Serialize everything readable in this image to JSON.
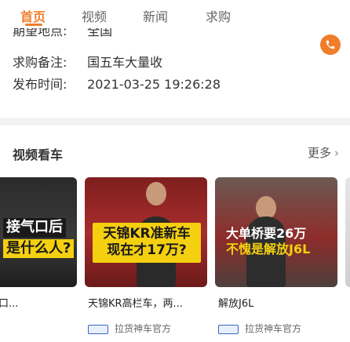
{
  "tabs": [
    {
      "label": "首页",
      "active": true
    },
    {
      "label": "视频",
      "active": false
    },
    {
      "label": "新闻",
      "active": false
    },
    {
      "label": "求购",
      "active": false
    }
  ],
  "info": {
    "cut_row": {
      "key": "期望地点:",
      "value": "全国"
    },
    "remark": {
      "key": "求购备注:",
      "value": "国五车大量收"
    },
    "publish_time": {
      "key": "发布时间:",
      "value": "2021-03-25 19:26:28"
    }
  },
  "phone_icon": "phone-icon",
  "section": {
    "title": "视频看车",
    "more_label": "更多",
    "more_icon": "chevron-right-icon"
  },
  "videos": [
    {
      "cap_line1": "接气口后",
      "cap_line2": "是什么人?",
      "title": "卡车接气口...",
      "source": ""
    },
    {
      "cap_line1": "天锦KR准新车",
      "cap_line2": "现在才17万?",
      "title": "天锦KR高栏车，两...",
      "source": "拉货神车官方"
    },
    {
      "cap_line1": "大单桥要26万",
      "cap_line2": "不愧是解放J6L",
      "title": "解放J6L",
      "source": "拉货神车官方"
    }
  ],
  "colors": {
    "accent": "#f07d2b",
    "caption_yellow": "#f4d010"
  }
}
